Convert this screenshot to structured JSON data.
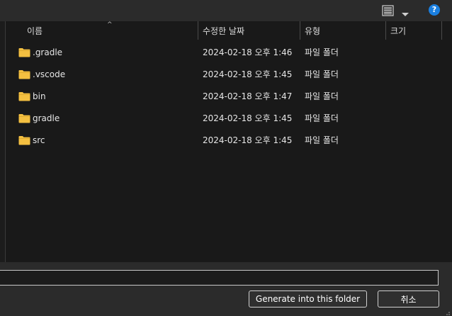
{
  "toolbar": {
    "view_icon": "list-view-icon",
    "dropdown_icon": "chevron-down-icon",
    "help_label": "?"
  },
  "columns": [
    {
      "label": "이름"
    },
    {
      "label": "수정한 날짜"
    },
    {
      "label": "유형"
    },
    {
      "label": "크기"
    }
  ],
  "sort_indicator": "^",
  "files": [
    {
      "name": ".gradle",
      "modified": "2024-02-18 오후 1:46",
      "type": "파일 폴더",
      "size": ""
    },
    {
      "name": ".vscode",
      "modified": "2024-02-18 오후 1:45",
      "type": "파일 폴더",
      "size": ""
    },
    {
      "name": "bin",
      "modified": "2024-02-18 오후 1:47",
      "type": "파일 폴더",
      "size": ""
    },
    {
      "name": "gradle",
      "modified": "2024-02-18 오후 1:45",
      "type": "파일 폴더",
      "size": ""
    },
    {
      "name": "src",
      "modified": "2024-02-18 오후 1:45",
      "type": "파일 폴더",
      "size": ""
    }
  ],
  "filename_input": {
    "value": ""
  },
  "buttons": {
    "generate": "Generate into this folder",
    "cancel": "취소"
  },
  "colors": {
    "folder": "#f4c041",
    "accent": "#1a7fe0"
  }
}
